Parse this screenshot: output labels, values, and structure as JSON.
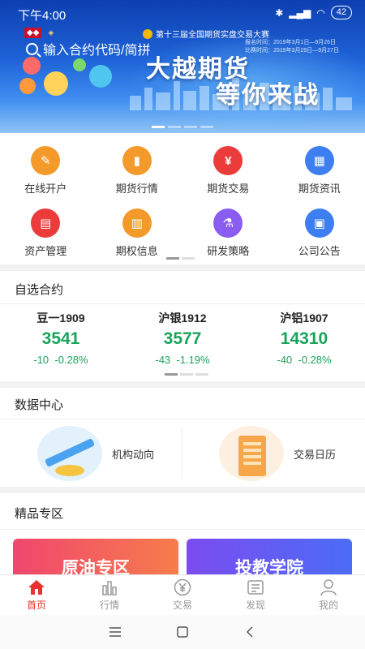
{
  "status_bar": {
    "time": "下午4:00",
    "battery": "42"
  },
  "banner": {
    "search_placeholder": "输入合约代码/简拼",
    "contest_title": "第十三届全国期货实盘交易大赛",
    "dates": [
      "报名时间：2019年3月1日—9月26日",
      "比赛时间：2019年3月29日—9月27日"
    ],
    "slogan_line1": "大越期货",
    "slogan_line2": "等你来战"
  },
  "functions": [
    {
      "label": "在线开户",
      "icon": "account-open-icon",
      "color": "#f39a2b",
      "glyph": "✎"
    },
    {
      "label": "期货行情",
      "icon": "bar-chart-icon",
      "color": "#f39a2b",
      "glyph": "▮"
    },
    {
      "label": "期货交易",
      "icon": "yen-coin-icon",
      "color": "#ec3b3b",
      "glyph": "¥"
    },
    {
      "label": "期货资讯",
      "icon": "news-grid-icon",
      "color": "#3d7ef0",
      "glyph": "▦"
    },
    {
      "label": "资产管理",
      "icon": "wallet-icon",
      "color": "#ec3b3b",
      "glyph": "▤"
    },
    {
      "label": "期权信息",
      "icon": "building-icon",
      "color": "#f39a2b",
      "glyph": "▥"
    },
    {
      "label": "研发策略",
      "icon": "flask-icon",
      "color": "#8a5cf0",
      "glyph": "⚗"
    },
    {
      "label": "公司公告",
      "icon": "notice-icon",
      "color": "#3d7ef0",
      "glyph": "▣"
    }
  ],
  "watchlist": {
    "title": "自选合约",
    "quotes": [
      {
        "name": "豆一1909",
        "price": "3541",
        "change": "-10",
        "pct": "-0.28%"
      },
      {
        "name": "沪银1912",
        "price": "3577",
        "change": "-43",
        "pct": "-1.19%"
      },
      {
        "name": "沪铝1907",
        "price": "14310",
        "change": "-40",
        "pct": "-0.28%"
      }
    ],
    "down_color": "#1aa35b"
  },
  "data_center": {
    "title": "数据中心",
    "items": [
      {
        "label": "机构动向",
        "icon": "rising-arrow-illustration"
      },
      {
        "label": "交易日历",
        "icon": "calendar-building-illustration"
      }
    ]
  },
  "premium": {
    "title": "精品专区",
    "items": [
      {
        "label": "原油专区"
      },
      {
        "label": "投教学院"
      }
    ]
  },
  "tabbar": {
    "active_color": "#e8322d",
    "items": [
      {
        "label": "首页",
        "icon": "home-icon"
      },
      {
        "label": "行情",
        "icon": "chart-icon"
      },
      {
        "label": "交易",
        "icon": "yen-circle-icon"
      },
      {
        "label": "发现",
        "icon": "discover-icon"
      },
      {
        "label": "我的",
        "icon": "person-icon"
      }
    ]
  }
}
